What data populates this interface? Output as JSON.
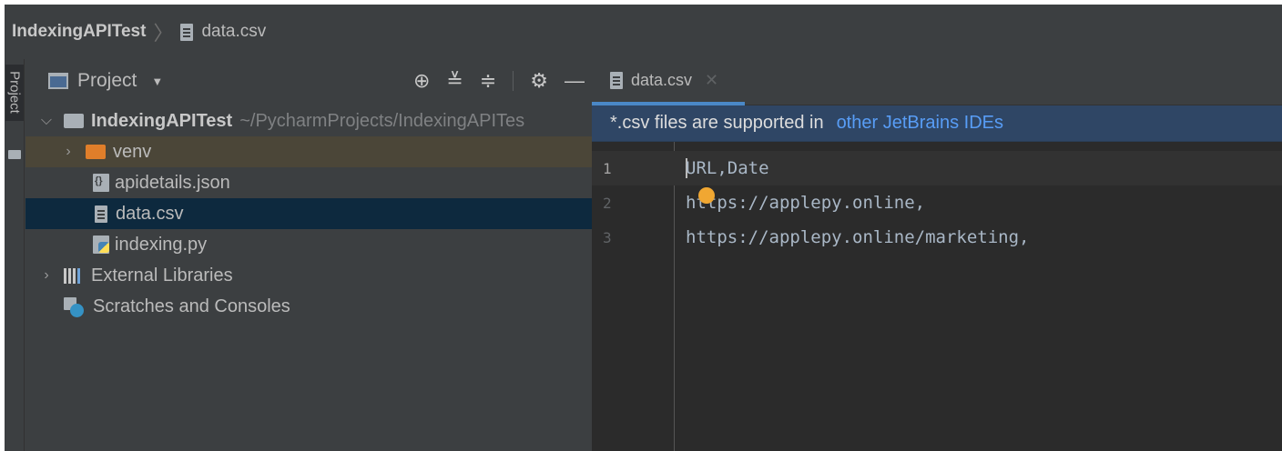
{
  "breadcrumb": {
    "project": "IndexingAPITest",
    "file": "data.csv"
  },
  "sidebar_strip": {
    "label": "Project"
  },
  "project_panel": {
    "title": "Project",
    "tree": [
      {
        "name": "IndexingAPITest",
        "path": "~/PycharmProjects/IndexingAPITes",
        "expanded": true
      },
      {
        "name": "venv",
        "expanded": false
      },
      {
        "name": "apidetails.json"
      },
      {
        "name": "data.csv",
        "selected": true
      },
      {
        "name": "indexing.py"
      },
      {
        "name": "External Libraries",
        "expanded": false
      },
      {
        "name": "Scratches and Consoles"
      }
    ]
  },
  "editor": {
    "tab_label": "data.csv",
    "banner_text": "*.csv files are supported in",
    "banner_link": "other JetBrains IDEs",
    "lines": [
      {
        "num": "1",
        "text": "URL,Date"
      },
      {
        "num": "2",
        "text": "https://applepy.online,"
      },
      {
        "num": "3",
        "text": "https://applepy.online/marketing,"
      }
    ]
  },
  "colors": {
    "accent": "#4a88c7",
    "link": "#589df6",
    "selection": "#0d293e",
    "folder_excluded": "#e07e2a"
  }
}
